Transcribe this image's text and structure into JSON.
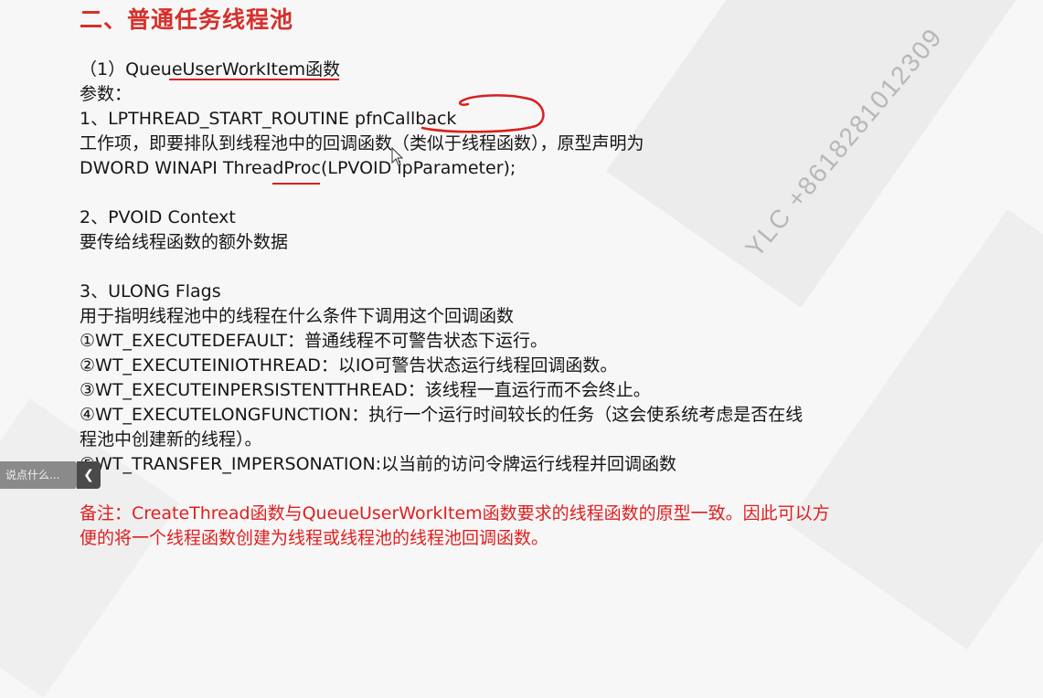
{
  "slide": {
    "title": "二、普通任务线程池",
    "lines": [
      "（1）QueueUserWorkItem函数",
      "参数：",
      "1、LPTHREAD_START_ROUTINE pfnCallback",
      "工作项，即要排队到线程池中的回调函数（类似于线程函数），原型声明为",
      "DWORD WINAPI ThreadProc(LPVOID lpParameter);",
      "2、PVOID Context",
      "要传给线程函数的额外数据",
      "3、ULONG Flags",
      "用于指明线程池中的线程在什么条件下调用这个回调函数",
      "①WT_EXECUTEDEFAULT：普通线程不可警告状态下运行。",
      "②WT_EXECUTEINIOTHREAD：以IO可警告状态运行线程回调函数。",
      "③WT_EXECUTEINPERSISTENTTHREAD：该线程一直运行而不会终止。",
      "④WT_EXECUTELONGFUNCTION：执行一个运行时间较长的任务（这会使系统考虑是否在线",
      "程池中创建新的线程）。",
      "⑤WT_TRANSFER_IMPERSONATION:以当前的访问令牌运行线程并回调函数"
    ],
    "note_lines": [
      "备注：CreateThread函数与QueueUserWorkItem函数要求的线程函数的原型一致。因此可以方",
      "便的将一个线程函数创建为线程或线程池的线程池回调函数。"
    ]
  },
  "watermark": "YLC +8618281012309",
  "comment_input": {
    "placeholder": "说点什么..."
  },
  "collapse_icon": "chevron-left-icon",
  "colors": {
    "title": "#d5302a",
    "note": "#e01f1f",
    "annotation": "#d8201f",
    "watermark": "#b7b7b7"
  }
}
